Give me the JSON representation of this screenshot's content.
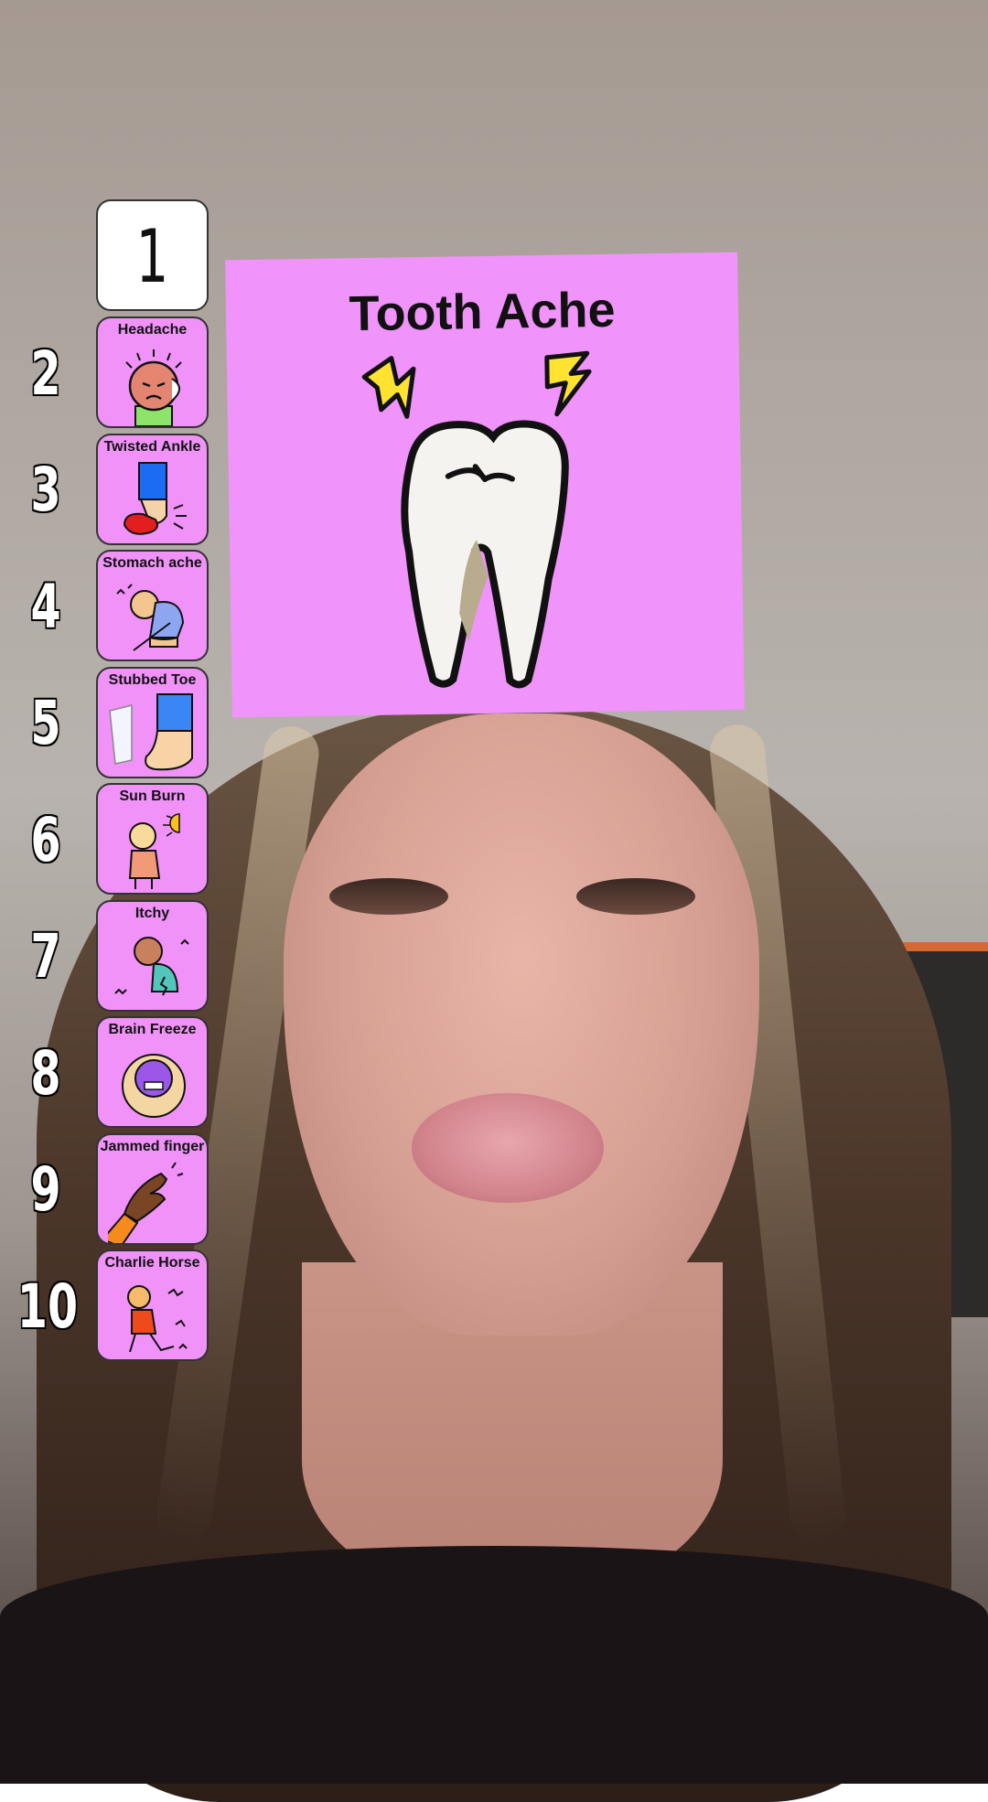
{
  "filter": {
    "current_slot": "1",
    "card_title": "Tooth Ache",
    "card_icon": "tooth-ache-icon",
    "ranks": [
      "2",
      "3",
      "4",
      "5",
      "6",
      "7",
      "8",
      "9",
      "10"
    ],
    "items": [
      {
        "label": "Headache",
        "icon": "headache-icon"
      },
      {
        "label": "Twisted Ankle",
        "icon": "twisted-ankle-icon"
      },
      {
        "label": "Stomach ache",
        "icon": "stomach-ache-icon"
      },
      {
        "label": "Stubbed Toe",
        "icon": "stubbed-toe-icon"
      },
      {
        "label": "Sun Burn",
        "icon": "sun-burn-icon"
      },
      {
        "label": "Itchy",
        "icon": "itchy-icon"
      },
      {
        "label": "Brain Freeze",
        "icon": "brain-freeze-icon"
      },
      {
        "label": "Jammed finger",
        "icon": "jammed-finger-icon"
      },
      {
        "label": "Charlie Horse",
        "icon": "charlie-horse-icon"
      }
    ],
    "colors": {
      "card": "#f093fb",
      "slot": "#f092f8"
    }
  }
}
